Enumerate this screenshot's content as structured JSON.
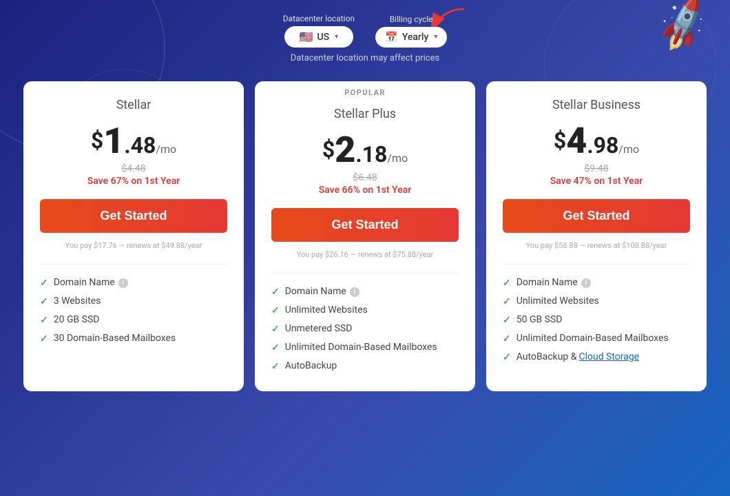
{
  "header": {
    "datacenter_label": "Datacenter location",
    "billing_label": "Billing cycle",
    "datacenter_value": "US",
    "billing_value": "Yearly",
    "datacenter_note": "Datacenter location may affect prices"
  },
  "plans": [
    {
      "id": "stellar",
      "popular": false,
      "popular_label": "",
      "name": "Stellar",
      "price_dollar": "$",
      "price_integer": "1",
      "price_decimal": ".48",
      "price_unit": "/mo",
      "original_price": "$4.48",
      "save_text": "Save 67% on 1st Year",
      "cta_label": "Get Started",
      "renewal_note": "You pay $17.76 — renews at $49.88/year",
      "features": [
        {
          "text": "Domain Name",
          "has_info": true,
          "has_link": false,
          "link_text": ""
        },
        {
          "text": "3 Websites",
          "has_info": false,
          "has_link": false,
          "link_text": ""
        },
        {
          "text": "20 GB SSD",
          "has_info": false,
          "has_link": false,
          "link_text": ""
        },
        {
          "text": "30 Domain-Based Mailboxes",
          "has_info": false,
          "has_link": false,
          "link_text": ""
        }
      ]
    },
    {
      "id": "stellar-plus",
      "popular": true,
      "popular_label": "POPULAR",
      "name": "Stellar Plus",
      "price_dollar": "$",
      "price_integer": "2",
      "price_decimal": ".18",
      "price_unit": "/mo",
      "original_price": "$6.48",
      "save_text": "Save 66% on 1st Year",
      "cta_label": "Get Started",
      "renewal_note": "You pay $26.16 — renews at $75.88/year",
      "features": [
        {
          "text": "Domain Name",
          "has_info": true,
          "has_link": false,
          "link_text": ""
        },
        {
          "text": "Unlimited Websites",
          "has_info": false,
          "has_link": false,
          "link_text": ""
        },
        {
          "text": "Unmetered SSD",
          "has_info": false,
          "has_link": false,
          "link_text": ""
        },
        {
          "text": "Unlimited Domain-Based Mailboxes",
          "has_info": false,
          "has_link": false,
          "link_text": ""
        },
        {
          "text": "AutoBackup",
          "has_info": false,
          "has_link": false,
          "link_text": ""
        }
      ]
    },
    {
      "id": "stellar-business",
      "popular": false,
      "popular_label": "",
      "name": "Stellar Business",
      "price_dollar": "$",
      "price_integer": "4",
      "price_decimal": ".98",
      "price_unit": "/mo",
      "original_price": "$9.48",
      "save_text": "Save 47% on 1st Year",
      "cta_label": "Get Started",
      "renewal_note": "You pay $58.88 — renews at $108.88/year",
      "features": [
        {
          "text": "Domain Name",
          "has_info": true,
          "has_link": false,
          "link_text": ""
        },
        {
          "text": "Unlimited Websites",
          "has_info": false,
          "has_link": false,
          "link_text": ""
        },
        {
          "text": "50 GB SSD",
          "has_info": false,
          "has_link": false,
          "link_text": ""
        },
        {
          "text": "Unlimited Domain-Based Mailboxes",
          "has_info": false,
          "has_link": false,
          "link_text": ""
        },
        {
          "text": "AutoBackup & ",
          "has_info": false,
          "has_link": true,
          "link_text": "Cloud Storage"
        }
      ]
    }
  ]
}
